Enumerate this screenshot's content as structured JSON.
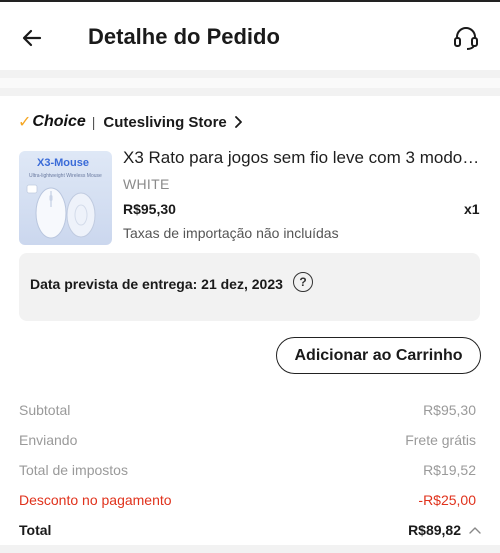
{
  "header": {
    "title": "Detalhe do Pedido",
    "back_icon": "arrow-left-icon",
    "support_icon": "headset-icon"
  },
  "store": {
    "badge_label": "Choice",
    "badge_separator": "|",
    "name": "Cutesliving Store",
    "chevron_icon": "chevron-right-icon"
  },
  "product": {
    "image_title": "X3-Mouse",
    "image_subtitle": "Ultra-lightweight Wireless Mouse",
    "title": "X3 Rato para jogos sem fio leve com 3 modo…",
    "variant": "WHITE",
    "price": "R$95,30",
    "quantity": "x1",
    "tax_note": "Taxas de importação não incluídas"
  },
  "delivery": {
    "text": "Data prevista de entrega: 21 dez, 2023",
    "help_symbol": "?"
  },
  "actions": {
    "add_to_cart": "Adicionar ao Carrinho"
  },
  "summary": {
    "subtotal_label": "Subtotal",
    "subtotal_value": "R$95,30",
    "shipping_label": "Enviando",
    "shipping_value": "Frete grátis",
    "tax_label": "Total de impostos",
    "tax_value": "R$19,52",
    "discount_label": "Desconto no pagamento",
    "discount_value": "-R$25,00",
    "total_label": "Total",
    "total_value": "R$89,82"
  },
  "colors": {
    "accent_orange": "#f5a623",
    "discount_red": "#e0321c",
    "muted_text": "#9a9a9a"
  }
}
